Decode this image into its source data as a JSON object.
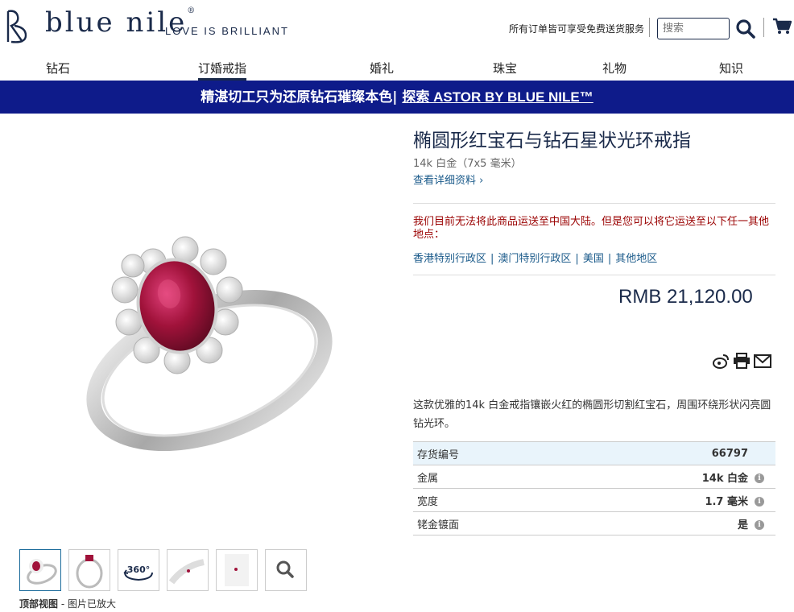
{
  "header": {
    "brand": "blue nile",
    "brand_mark": "®",
    "tagline": "LOVE IS BRILLIANT",
    "shipping_text": "所有订单皆可享受免费送货服务",
    "search_placeholder": "搜索"
  },
  "nav": {
    "items": [
      {
        "label": "钻石"
      },
      {
        "label": "订婚戒指"
      },
      {
        "label": "婚礼"
      },
      {
        "label": "珠宝"
      },
      {
        "label": "礼物"
      },
      {
        "label": "知识"
      }
    ]
  },
  "banner": {
    "text": "精湛切工只为还原钻石璀璨本色|",
    "link": "探索 ASTOR BY BLUE NILE™"
  },
  "product": {
    "title": "椭圆形红宝石与钻石星状光环戒指",
    "subtitle": "14k 白金（7x5 毫米）",
    "details_link": "查看详细资料 ›",
    "warning": "我们目前无法将此商品运送至中国大陆。但是您可以将它运送至以下任一其他地点：",
    "regions": [
      "香港特别行政区",
      "澳门特别行政区",
      "美国",
      "其他地区"
    ],
    "price": "RMB 21,120.00",
    "description": "这款优雅的14k 白金戒指镶嵌火红的椭圆形切割红宝石，周围环绕形状闪亮圆钻光环。",
    "specs": [
      {
        "label": "存货编号",
        "value": "66797"
      },
      {
        "label": "金属",
        "value": "14k 白金"
      },
      {
        "label": "宽度",
        "value": "1.7 毫米"
      },
      {
        "label": "铑金镀面",
        "value": "是"
      }
    ]
  },
  "thumbnails": {
    "caption_bold": "顶部视图",
    "caption_rest": " - 图片已放大",
    "badge_360": "360°"
  },
  "colors": {
    "brand_navy": "#1a2a4a",
    "banner_blue": "#0e1b8a",
    "link_blue": "#1a5a8a",
    "warning_red": "#9a0000",
    "ruby": "#a0123a"
  }
}
